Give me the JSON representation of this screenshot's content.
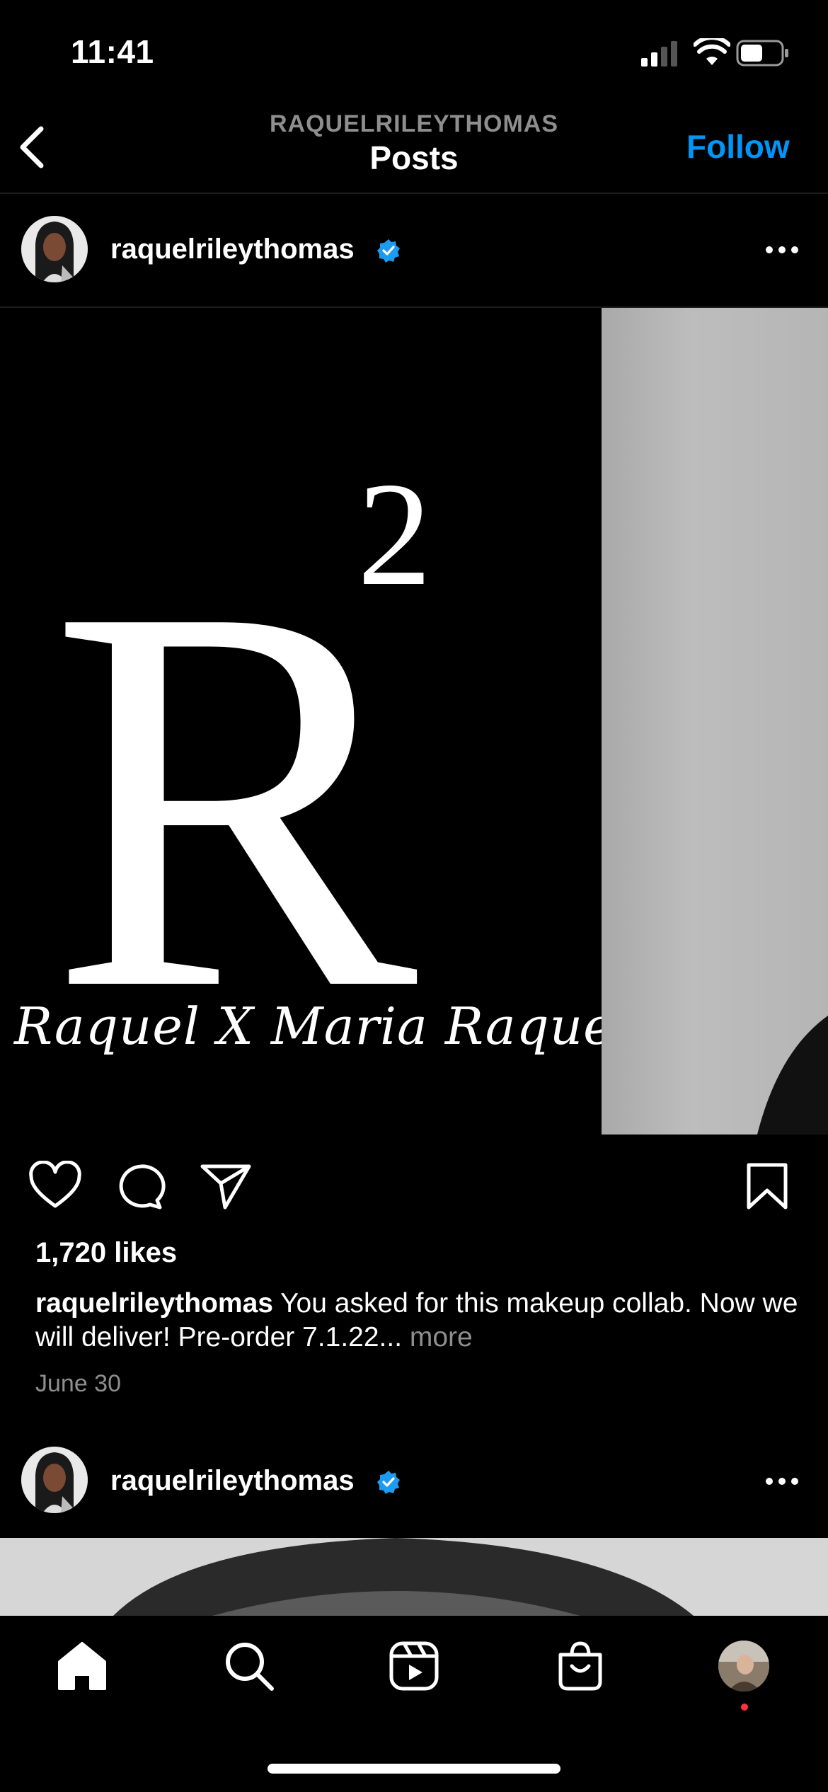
{
  "status_bar": {
    "time": "11:41"
  },
  "nav": {
    "subtitle": "RAQUELRILEYTHOMAS",
    "title": "Posts",
    "follow_label": "Follow"
  },
  "post": {
    "username": "raquelrileythomas",
    "image_logo_main": "R",
    "image_logo_superscript": "2",
    "image_logo_script": "Raquel X Maria Raquel",
    "likes": "1,720 likes",
    "caption_user": "raquelrileythomas",
    "caption_text": " You asked for this makeup collab. Now we will deliver!  Pre-order 7.1.22...",
    "caption_more": " more",
    "date": "June 30"
  },
  "post2": {
    "username": "raquelrileythomas"
  },
  "colors": {
    "accent": "#0095f6",
    "verified": "#1d9bf0",
    "muted": "#8e8e8e",
    "notification_dot": "#ff3040"
  },
  "icons": [
    "back-chevron-icon",
    "verified-badge-icon",
    "more-icon",
    "heart-icon",
    "comment-icon",
    "share-icon",
    "bookmark-icon",
    "home-icon",
    "search-icon",
    "reels-icon",
    "shop-icon",
    "profile-avatar"
  ]
}
